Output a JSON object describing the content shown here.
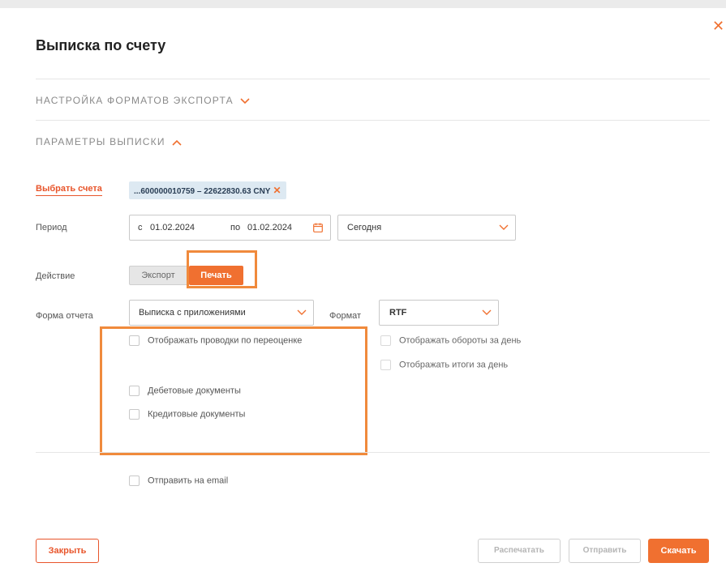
{
  "dialog": {
    "title": "Выписка по счету",
    "close_icon": "close-icon",
    "accent_color": "#f07030"
  },
  "sections": {
    "export_formats": "НАСТРОЙКА ФОРМАТОВ ЭКСПОРТА",
    "statement_params": "ПАРАМЕТРЫ ВЫПИСКИ"
  },
  "accounts": {
    "select_link": "Выбрать счета",
    "selected_tag": "...600000010759 – 22622830.63 CNY"
  },
  "period": {
    "label": "Период",
    "from_prefix": "с",
    "from_value": "01.02.2024",
    "to_prefix": "по",
    "to_value": "01.02.2024",
    "preset_value": "Сегодня"
  },
  "action": {
    "label": "Действие",
    "export_label": "Экспорт",
    "print_label": "Печать"
  },
  "report": {
    "form_label": "Форма отчета",
    "form_value": "Выписка с приложениями",
    "format_label": "Формат",
    "format_value": "RTF"
  },
  "checkboxes": {
    "revaluation": "Отображать проводки по переоценке",
    "daily_turnover": "Отображать обороты за день",
    "daily_totals": "Отображать итоги за день",
    "debit_docs": "Дебетовые документы",
    "credit_docs": "Кредитовые документы",
    "send_email": "Отправить на email"
  },
  "footer": {
    "close_label": "Закрыть",
    "print_label": "Распечатать",
    "send_label": "Отправить",
    "download_label": "Скачать"
  }
}
